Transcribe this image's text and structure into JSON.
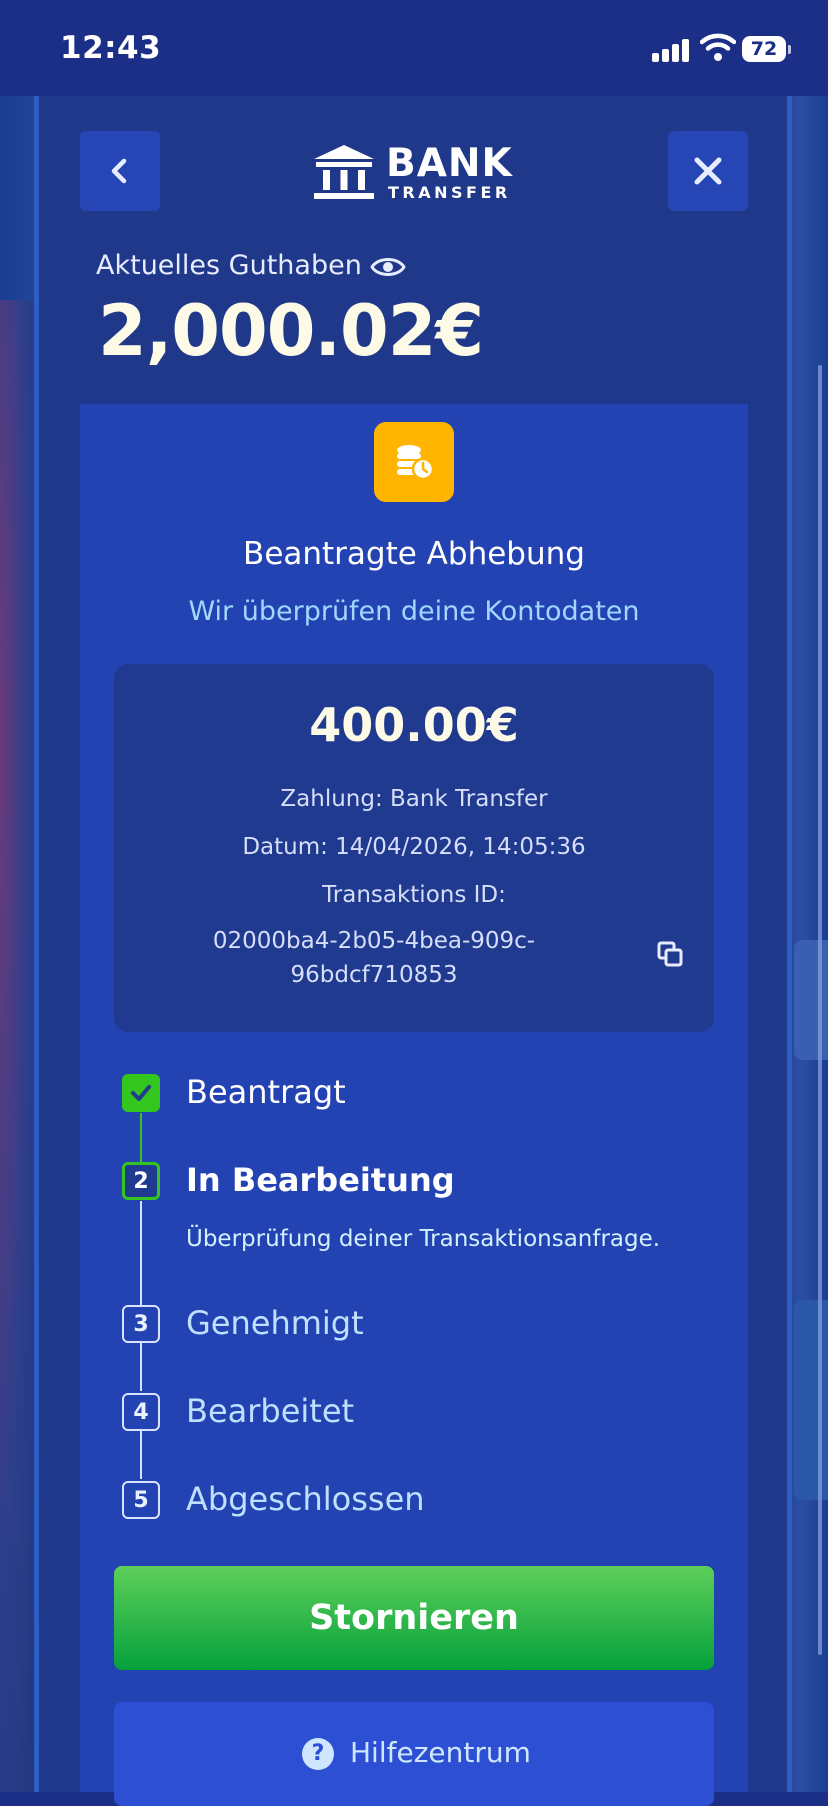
{
  "status_bar": {
    "time": "12:43",
    "battery": "72"
  },
  "header": {
    "logo_top": "BANK",
    "logo_bottom": "TRANSFER"
  },
  "balance": {
    "label": "Aktuelles Guthaben",
    "value": "2,000.02€"
  },
  "withdrawal": {
    "title": "Beantragte Abhebung",
    "subtitle": "Wir überprüfen deine Kontodaten",
    "amount": "400.00€",
    "payment": "Zahlung: Bank Transfer",
    "date": "Datum: 14/04/2026, 14:05:36",
    "txid_label": "Transaktions ID:",
    "txid_line1": "02000ba4-2b05-4bea-909c-",
    "txid_line2": "96bdcf710853"
  },
  "steps": [
    {
      "number": "1",
      "label": "Beantragt",
      "state": "done"
    },
    {
      "number": "2",
      "label": "In Bearbeitung",
      "state": "current",
      "description": "Überprüfung deiner Transaktionsanfrage."
    },
    {
      "number": "3",
      "label": "Genehmigt",
      "state": "pending"
    },
    {
      "number": "4",
      "label": "Bearbeitet",
      "state": "pending"
    },
    {
      "number": "5",
      "label": "Abgeschlossen",
      "state": "pending"
    }
  ],
  "actions": {
    "cancel_label": "Stornieren",
    "help_label": "Hilfezentrum"
  },
  "icons": [
    "back-icon",
    "close-icon",
    "bank-icon",
    "eye-icon",
    "coins-clock-icon",
    "copy-icon",
    "check-icon",
    "help-icon"
  ],
  "colors": {
    "accent_green": "#34c51f",
    "coin_yellow": "#ffb400",
    "subtitle_blue": "#9fd7ff"
  }
}
